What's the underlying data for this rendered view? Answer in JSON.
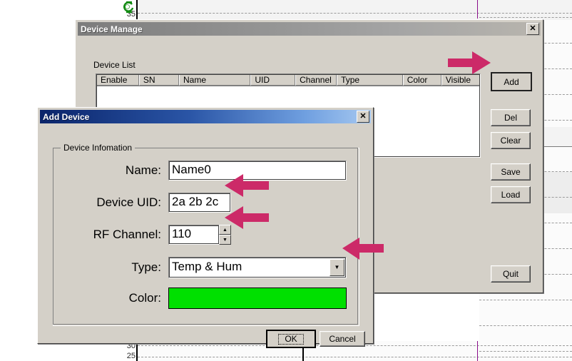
{
  "background_app": {
    "name": "temperature-chart-background",
    "y_axis_labels": [
      "35",
      "30",
      "25"
    ],
    "marker_icon": "circular-refresh-icon",
    "cursor_line_color": "#8a0c8a",
    "plot_bg": "#f3f3f3"
  },
  "device_manage": {
    "title": "Device Manage",
    "close_label": "✕",
    "list_label": "Device List",
    "columns": [
      "Enable",
      "SN",
      "Name",
      "UID",
      "Channel",
      "Type",
      "Color",
      "Visible"
    ],
    "rows": [],
    "buttons": {
      "add": "Add",
      "del": "Del",
      "clear": "Clear",
      "save": "Save",
      "load": "Load",
      "quit": "Quit"
    }
  },
  "add_device": {
    "title": "Add Device",
    "close_label": "✕",
    "group_title": "Device Infomation",
    "fields": {
      "name": {
        "label": "Name:",
        "value": "Name0"
      },
      "uid": {
        "label": "Device UID:",
        "value": "2a 2b 2c"
      },
      "rf_channel": {
        "label": "RF Channel:",
        "value": "110",
        "spin_up": "▲",
        "spin_down": "▼"
      },
      "type": {
        "label": "Type:",
        "value": "Temp & Hum",
        "dropdown_glyph": "▼"
      },
      "color": {
        "label": "Color:",
        "value": "#00E000"
      }
    },
    "ok_label": "OK",
    "cancel_label": "Cancel"
  },
  "annotations": {
    "arrow_color": "#cc2a68",
    "arrows": [
      {
        "name": "arrow-to-add-button",
        "direction": "right"
      },
      {
        "name": "arrow-to-device-uid",
        "direction": "left"
      },
      {
        "name": "arrow-to-rf-channel",
        "direction": "left"
      },
      {
        "name": "arrow-to-type-dropdown",
        "direction": "left"
      }
    ]
  }
}
